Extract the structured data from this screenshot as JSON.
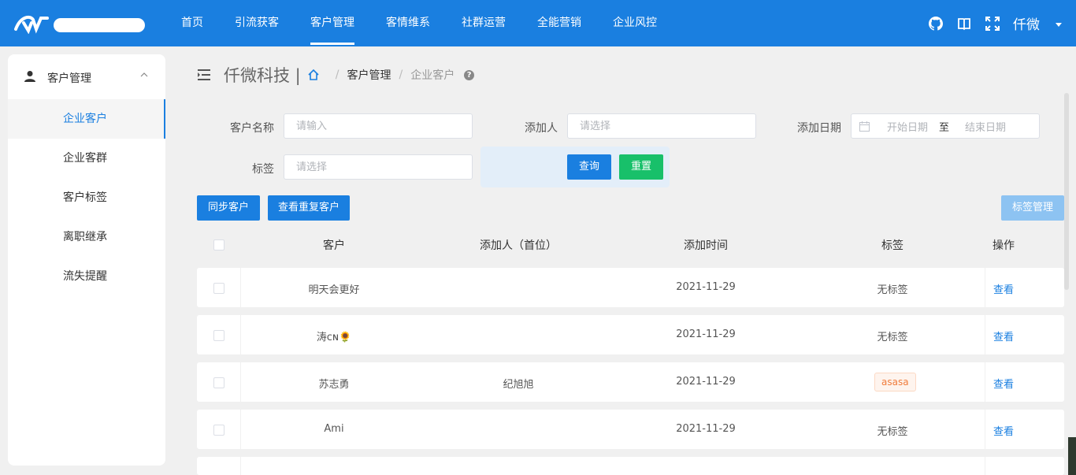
{
  "nav": {
    "items": [
      "首页",
      "引流获客",
      "客户管理",
      "客情维系",
      "社群运营",
      "全能营销",
      "企业风控"
    ],
    "active": "客户管理",
    "user": "仟微"
  },
  "sidebar": {
    "header": "客户管理",
    "items": [
      "企业客户",
      "企业客群",
      "客户标签",
      "离职继承",
      "流失提醒"
    ],
    "active": "企业客户"
  },
  "breadcrumb": {
    "company": "仟微科技 |",
    "sep": "/",
    "parent": "客户管理",
    "current": "企业客户",
    "help": "?"
  },
  "filters": {
    "customer_name_label": "客户名称",
    "customer_name_placeholder": "请输入",
    "adder_label": "添加人",
    "adder_placeholder": "请选择",
    "date_label": "添加日期",
    "date_start_placeholder": "开始日期",
    "date_to": "至",
    "date_end_placeholder": "结束日期",
    "tag_label": "标签",
    "tag_placeholder": "请选择",
    "query_btn": "查询",
    "reset_btn": "重置"
  },
  "actions": {
    "sync_btn": "同步客户",
    "dup_btn": "查看重复客户",
    "tag_mgmt_btn": "标签管理"
  },
  "table": {
    "headers": [
      "客户",
      "添加人（首位）",
      "添加时间",
      "标签",
      "操作"
    ],
    "rows": [
      {
        "customer": "明天会更好",
        "adder": "",
        "time": "2021-11-29",
        "tag": "无标签",
        "tag_style": "plain",
        "op": "查看"
      },
      {
        "customer": "涛ᴄɴ🌻",
        "adder": "",
        "time": "2021-11-29",
        "tag": "无标签",
        "tag_style": "plain",
        "op": "查看"
      },
      {
        "customer": "苏志勇",
        "adder": "纪旭旭",
        "time": "2021-11-29",
        "tag": "asasa",
        "tag_style": "badge",
        "op": "查看"
      },
      {
        "customer": "Ami",
        "adder": "",
        "time": "2021-11-29",
        "tag": "无标签",
        "tag_style": "plain",
        "op": "查看"
      }
    ]
  },
  "colors": {
    "primary": "#1a7fe0",
    "success": "#18c06a",
    "tag_text": "#f07c3c"
  },
  "icons": [
    "logo-icon",
    "github-icon",
    "book-icon",
    "fullscreen-icon",
    "person-icon",
    "chevron-up-icon",
    "menu-fold-icon",
    "home-icon",
    "help-icon",
    "calendar-icon"
  ]
}
